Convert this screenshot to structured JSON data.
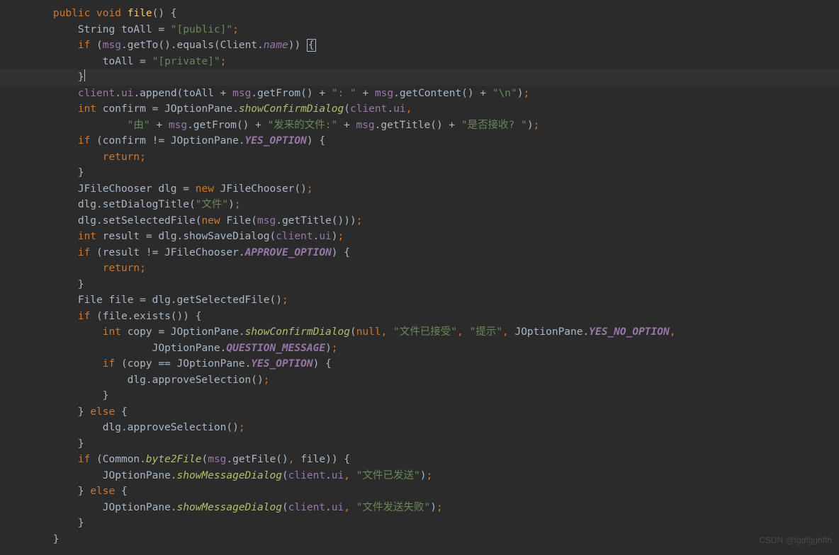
{
  "code": {
    "tokens": [
      [
        {
          "t": "    ",
          "c": ""
        },
        {
          "t": "public void ",
          "c": "kw"
        },
        {
          "t": "file",
          "c": "method"
        },
        {
          "t": "() {",
          "c": "paren"
        }
      ],
      [
        {
          "t": "        ",
          "c": ""
        },
        {
          "t": "String ",
          "c": "type"
        },
        {
          "t": "toAll = ",
          "c": "ident"
        },
        {
          "t": "\"[public]\"",
          "c": "str"
        },
        {
          "t": ";",
          "c": "punc"
        }
      ],
      [
        {
          "t": "        ",
          "c": ""
        },
        {
          "t": "if ",
          "c": "kw"
        },
        {
          "t": "(",
          "c": "paren"
        },
        {
          "t": "msg",
          "c": "field"
        },
        {
          "t": ".getTo().equals(",
          "c": "ident"
        },
        {
          "t": "Client",
          "c": "type"
        },
        {
          "t": ".",
          "c": "ident"
        },
        {
          "t": "name",
          "c": "static"
        },
        {
          "t": ")) ",
          "c": "paren"
        },
        {
          "t": "{",
          "c": "paren",
          "box": true
        }
      ],
      [
        {
          "t": "            toAll = ",
          "c": "ident"
        },
        {
          "t": "\"[private]\"",
          "c": "str"
        },
        {
          "t": ";",
          "c": "punc"
        }
      ],
      [
        {
          "t": "        }",
          "c": "paren"
        },
        {
          "t": "",
          "c": "",
          "cursor": true
        }
      ],
      [
        {
          "t": "        ",
          "c": ""
        },
        {
          "t": "client",
          "c": "field"
        },
        {
          "t": ".",
          "c": "ident"
        },
        {
          "t": "ui",
          "c": "field"
        },
        {
          "t": ".append(toAll + ",
          "c": "ident"
        },
        {
          "t": "msg",
          "c": "field"
        },
        {
          "t": ".getFrom() + ",
          "c": "ident"
        },
        {
          "t": "\": \"",
          "c": "str"
        },
        {
          "t": " + ",
          "c": "ident"
        },
        {
          "t": "msg",
          "c": "field"
        },
        {
          "t": ".getContent() + ",
          "c": "ident"
        },
        {
          "t": "\"\\n\"",
          "c": "str"
        },
        {
          "t": ")",
          "c": "paren"
        },
        {
          "t": ";",
          "c": "punc"
        }
      ],
      [
        {
          "t": "        ",
          "c": ""
        },
        {
          "t": "int ",
          "c": "kw"
        },
        {
          "t": "confirm = ",
          "c": "ident"
        },
        {
          "t": "JOptionPane",
          "c": "type"
        },
        {
          "t": ".",
          "c": "ident"
        },
        {
          "t": "showConfirmDialog",
          "c": "static-call"
        },
        {
          "t": "(",
          "c": "paren"
        },
        {
          "t": "client",
          "c": "field"
        },
        {
          "t": ".",
          "c": "ident"
        },
        {
          "t": "ui",
          "c": "field"
        },
        {
          "t": ",",
          "c": "punc"
        }
      ],
      [
        {
          "t": "                ",
          "c": ""
        },
        {
          "t": "\"由\"",
          "c": "str"
        },
        {
          "t": " + ",
          "c": "ident"
        },
        {
          "t": "msg",
          "c": "field"
        },
        {
          "t": ".getFrom() + ",
          "c": "ident"
        },
        {
          "t": "\"发来的文件:\"",
          "c": "str"
        },
        {
          "t": " + ",
          "c": "ident"
        },
        {
          "t": "msg",
          "c": "field"
        },
        {
          "t": ".getTitle() + ",
          "c": "ident"
        },
        {
          "t": "\"是否接收? \"",
          "c": "str"
        },
        {
          "t": ")",
          "c": "paren"
        },
        {
          "t": ";",
          "c": "punc"
        }
      ],
      [
        {
          "t": "        ",
          "c": ""
        },
        {
          "t": "if ",
          "c": "kw"
        },
        {
          "t": "(confirm != ",
          "c": "ident"
        },
        {
          "t": "JOptionPane",
          "c": "type"
        },
        {
          "t": ".",
          "c": "ident"
        },
        {
          "t": "YES_OPTION",
          "c": "const"
        },
        {
          "t": ") {",
          "c": "paren"
        }
      ],
      [
        {
          "t": "            ",
          "c": ""
        },
        {
          "t": "return;",
          "c": "kw"
        }
      ],
      [
        {
          "t": "        }",
          "c": "paren"
        }
      ],
      [
        {
          "t": "        ",
          "c": ""
        },
        {
          "t": "JFileChooser ",
          "c": "type"
        },
        {
          "t": "dlg = ",
          "c": "ident"
        },
        {
          "t": "new ",
          "c": "kw"
        },
        {
          "t": "JFileChooser()",
          "c": "ident"
        },
        {
          "t": ";",
          "c": "punc"
        }
      ],
      [
        {
          "t": "        dlg.setDialogTitle(",
          "c": "ident"
        },
        {
          "t": "\"文件\"",
          "c": "str"
        },
        {
          "t": ")",
          "c": "paren"
        },
        {
          "t": ";",
          "c": "punc"
        }
      ],
      [
        {
          "t": "        dlg.setSelectedFile(",
          "c": "ident"
        },
        {
          "t": "new ",
          "c": "kw"
        },
        {
          "t": "File(",
          "c": "ident"
        },
        {
          "t": "msg",
          "c": "field"
        },
        {
          "t": ".getTitle()))",
          "c": "ident"
        },
        {
          "t": ";",
          "c": "punc"
        }
      ],
      [
        {
          "t": "        ",
          "c": ""
        },
        {
          "t": "int ",
          "c": "kw"
        },
        {
          "t": "result = dlg.showSaveDialog(",
          "c": "ident"
        },
        {
          "t": "client",
          "c": "field"
        },
        {
          "t": ".",
          "c": "ident"
        },
        {
          "t": "ui",
          "c": "field"
        },
        {
          "t": ")",
          "c": "paren"
        },
        {
          "t": ";",
          "c": "punc"
        }
      ],
      [
        {
          "t": "        ",
          "c": ""
        },
        {
          "t": "if ",
          "c": "kw"
        },
        {
          "t": "(result != ",
          "c": "ident"
        },
        {
          "t": "JFileChooser",
          "c": "type"
        },
        {
          "t": ".",
          "c": "ident"
        },
        {
          "t": "APPROVE_OPTION",
          "c": "const"
        },
        {
          "t": ") {",
          "c": "paren"
        }
      ],
      [
        {
          "t": "            ",
          "c": ""
        },
        {
          "t": "return;",
          "c": "kw"
        }
      ],
      [
        {
          "t": "        }",
          "c": "paren"
        }
      ],
      [
        {
          "t": "        ",
          "c": ""
        },
        {
          "t": "File ",
          "c": "type"
        },
        {
          "t": "file = dlg.getSelectedFile()",
          "c": "ident"
        },
        {
          "t": ";",
          "c": "punc"
        }
      ],
      [
        {
          "t": "        ",
          "c": ""
        },
        {
          "t": "if ",
          "c": "kw"
        },
        {
          "t": "(file.exists()) {",
          "c": "ident"
        }
      ],
      [
        {
          "t": "            ",
          "c": ""
        },
        {
          "t": "int ",
          "c": "kw"
        },
        {
          "t": "copy = ",
          "c": "ident"
        },
        {
          "t": "JOptionPane",
          "c": "type"
        },
        {
          "t": ".",
          "c": "ident"
        },
        {
          "t": "showConfirmDialog",
          "c": "static-call"
        },
        {
          "t": "(",
          "c": "paren"
        },
        {
          "t": "null",
          "c": "kw"
        },
        {
          "t": ", ",
          "c": "punc"
        },
        {
          "t": "\"文件已接受\"",
          "c": "str"
        },
        {
          "t": ", ",
          "c": "punc"
        },
        {
          "t": "\"提示\"",
          "c": "str"
        },
        {
          "t": ", ",
          "c": "punc"
        },
        {
          "t": "JOptionPane",
          "c": "type"
        },
        {
          "t": ".",
          "c": "ident"
        },
        {
          "t": "YES_NO_OPTION",
          "c": "const"
        },
        {
          "t": ",",
          "c": "punc"
        }
      ],
      [
        {
          "t": "                    ",
          "c": ""
        },
        {
          "t": "JOptionPane",
          "c": "type"
        },
        {
          "t": ".",
          "c": "ident"
        },
        {
          "t": "QUESTION_MESSAGE",
          "c": "const"
        },
        {
          "t": ")",
          "c": "paren"
        },
        {
          "t": ";",
          "c": "punc"
        }
      ],
      [
        {
          "t": "            ",
          "c": ""
        },
        {
          "t": "if ",
          "c": "kw"
        },
        {
          "t": "(copy == ",
          "c": "ident"
        },
        {
          "t": "JOptionPane",
          "c": "type"
        },
        {
          "t": ".",
          "c": "ident"
        },
        {
          "t": "YES_OPTION",
          "c": "const"
        },
        {
          "t": ") {",
          "c": "paren"
        }
      ],
      [
        {
          "t": "                dlg.approveSelection()",
          "c": "ident"
        },
        {
          "t": ";",
          "c": "punc"
        }
      ],
      [
        {
          "t": "            }",
          "c": "paren"
        }
      ],
      [
        {
          "t": "        } ",
          "c": "paren"
        },
        {
          "t": "else ",
          "c": "kw"
        },
        {
          "t": "{",
          "c": "paren"
        }
      ],
      [
        {
          "t": "            dlg.approveSelection()",
          "c": "ident"
        },
        {
          "t": ";",
          "c": "punc"
        }
      ],
      [
        {
          "t": "        }",
          "c": "paren"
        }
      ],
      [
        {
          "t": "        ",
          "c": ""
        },
        {
          "t": "if ",
          "c": "kw"
        },
        {
          "t": "(",
          "c": "paren"
        },
        {
          "t": "Common",
          "c": "type"
        },
        {
          "t": ".",
          "c": "ident"
        },
        {
          "t": "byte2File",
          "c": "static-call"
        },
        {
          "t": "(",
          "c": "paren"
        },
        {
          "t": "msg",
          "c": "field"
        },
        {
          "t": ".getFile()",
          "c": "ident"
        },
        {
          "t": ", ",
          "c": "punc"
        },
        {
          "t": "file)) {",
          "c": "ident"
        }
      ],
      [
        {
          "t": "            ",
          "c": ""
        },
        {
          "t": "JOptionPane",
          "c": "type"
        },
        {
          "t": ".",
          "c": "ident"
        },
        {
          "t": "showMessageDialog",
          "c": "static-call"
        },
        {
          "t": "(",
          "c": "paren"
        },
        {
          "t": "client",
          "c": "field"
        },
        {
          "t": ".",
          "c": "ident"
        },
        {
          "t": "ui",
          "c": "field"
        },
        {
          "t": ", ",
          "c": "punc"
        },
        {
          "t": "\"文件已发送\"",
          "c": "str"
        },
        {
          "t": ")",
          "c": "paren"
        },
        {
          "t": ";",
          "c": "punc"
        }
      ],
      [
        {
          "t": "        } ",
          "c": "paren"
        },
        {
          "t": "else ",
          "c": "kw"
        },
        {
          "t": "{",
          "c": "paren"
        }
      ],
      [
        {
          "t": "            ",
          "c": ""
        },
        {
          "t": "JOptionPane",
          "c": "type"
        },
        {
          "t": ".",
          "c": "ident"
        },
        {
          "t": "showMessageDialog",
          "c": "static-call"
        },
        {
          "t": "(",
          "c": "paren"
        },
        {
          "t": "client",
          "c": "field"
        },
        {
          "t": ".",
          "c": "ident"
        },
        {
          "t": "ui",
          "c": "field"
        },
        {
          "t": ", ",
          "c": "punc"
        },
        {
          "t": "\"文件发送失败\"",
          "c": "str"
        },
        {
          "t": ")",
          "c": "paren"
        },
        {
          "t": ";",
          "c": "punc"
        }
      ],
      [
        {
          "t": "        }",
          "c": "paren"
        }
      ],
      [
        {
          "t": "    }",
          "c": "paren"
        }
      ]
    ],
    "highlighted_lines": [
      4
    ]
  },
  "watermark": "CSDN @fgdfgghfth"
}
